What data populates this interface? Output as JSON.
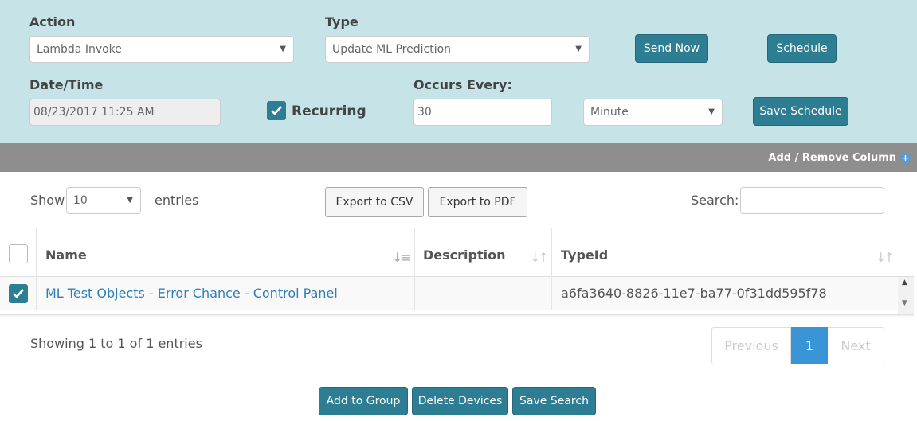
{
  "schedule": {
    "action_label": "Action",
    "action_value": "Lambda Invoke",
    "type_label": "Type",
    "type_value": "Update ML Prediction",
    "send_now": "Send Now",
    "schedule": "Schedule",
    "datetime_label": "Date/Time",
    "datetime_value": "08/23/2017 11:25 AM",
    "recurring_label": "Recurring",
    "recurring_checked": true,
    "occurs_label": "Occurs Every:",
    "occurs_value": "30",
    "unit_value": "Minute",
    "save_schedule": "Save Schedule"
  },
  "column_bar": {
    "add_remove": "Add / Remove Column"
  },
  "table_controls": {
    "show": "Show",
    "length_value": "10",
    "entries": "entries",
    "export_csv": "Export to CSV",
    "export_pdf": "Export to PDF",
    "search_label": "Search:",
    "search_value": ""
  },
  "table": {
    "columns": [
      "Name",
      "Description",
      "TypeId"
    ],
    "rows": [
      {
        "checked": true,
        "name": "ML Test Objects - Error Chance - Control Panel",
        "description": "",
        "typeid": "a6fa3640-8826-11e7-ba77-0f31dd595f78"
      }
    ]
  },
  "footer": {
    "info": "Showing 1 to 1 of 1 entries",
    "previous": "Previous",
    "page": "1",
    "next": "Next"
  },
  "actions": {
    "add_to_group": "Add to Group",
    "delete_devices": "Delete Devices",
    "save_search": "Save Search"
  },
  "colors": {
    "accent": "#2d7d93",
    "panel": "#c6e4e8",
    "bar": "#8e8e8e",
    "link": "#2f7fb8",
    "page_active": "#3a95d6"
  }
}
